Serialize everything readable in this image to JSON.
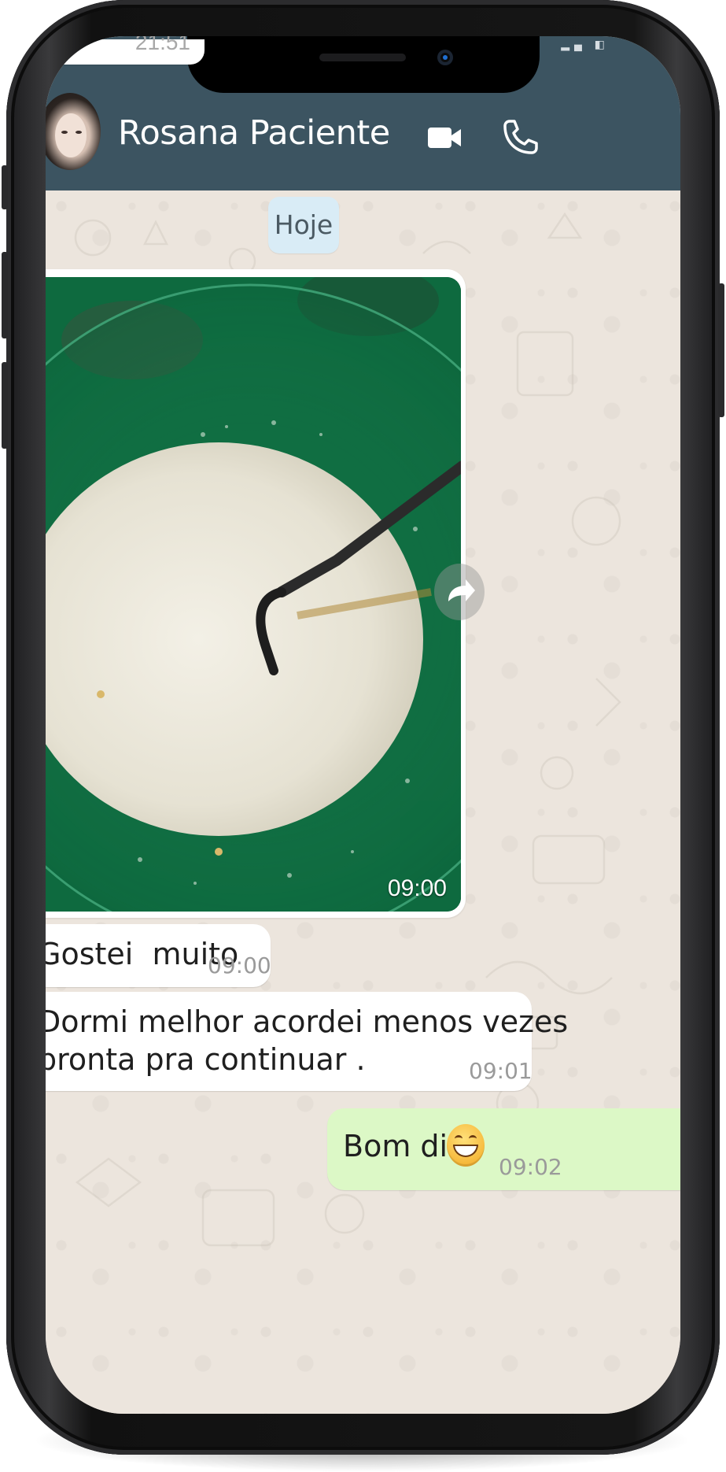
{
  "header": {
    "contact_name": "Rosana Paciente",
    "video_call_icon": "video-camera-icon",
    "voice_call_icon": "phone-icon"
  },
  "chat": {
    "previous_message_time": "21:51",
    "date_separator": "Hoje",
    "image_message": {
      "time": "09:00",
      "description_icon": "photo-bowl-milk-spoon"
    },
    "messages": [
      {
        "direction": "incoming",
        "lines": [
          "Gostei  muito"
        ],
        "time": "09:00"
      },
      {
        "direction": "incoming",
        "lines": [
          "Dormi melhor acordei menos vezes",
          "pronta pra continuar ."
        ],
        "time": "09:01"
      },
      {
        "direction": "outgoing",
        "lines": [
          "Bom dia"
        ],
        "emoji": "grinning-face-emoji",
        "time": "09:02"
      }
    ]
  },
  "colors": {
    "header_bg": "#3c5461",
    "wallpaper": "#ece5dd",
    "incoming_bubble": "#ffffff",
    "outgoing_bubble": "#dcf8c6",
    "date_chip": "#d9ecf6"
  }
}
